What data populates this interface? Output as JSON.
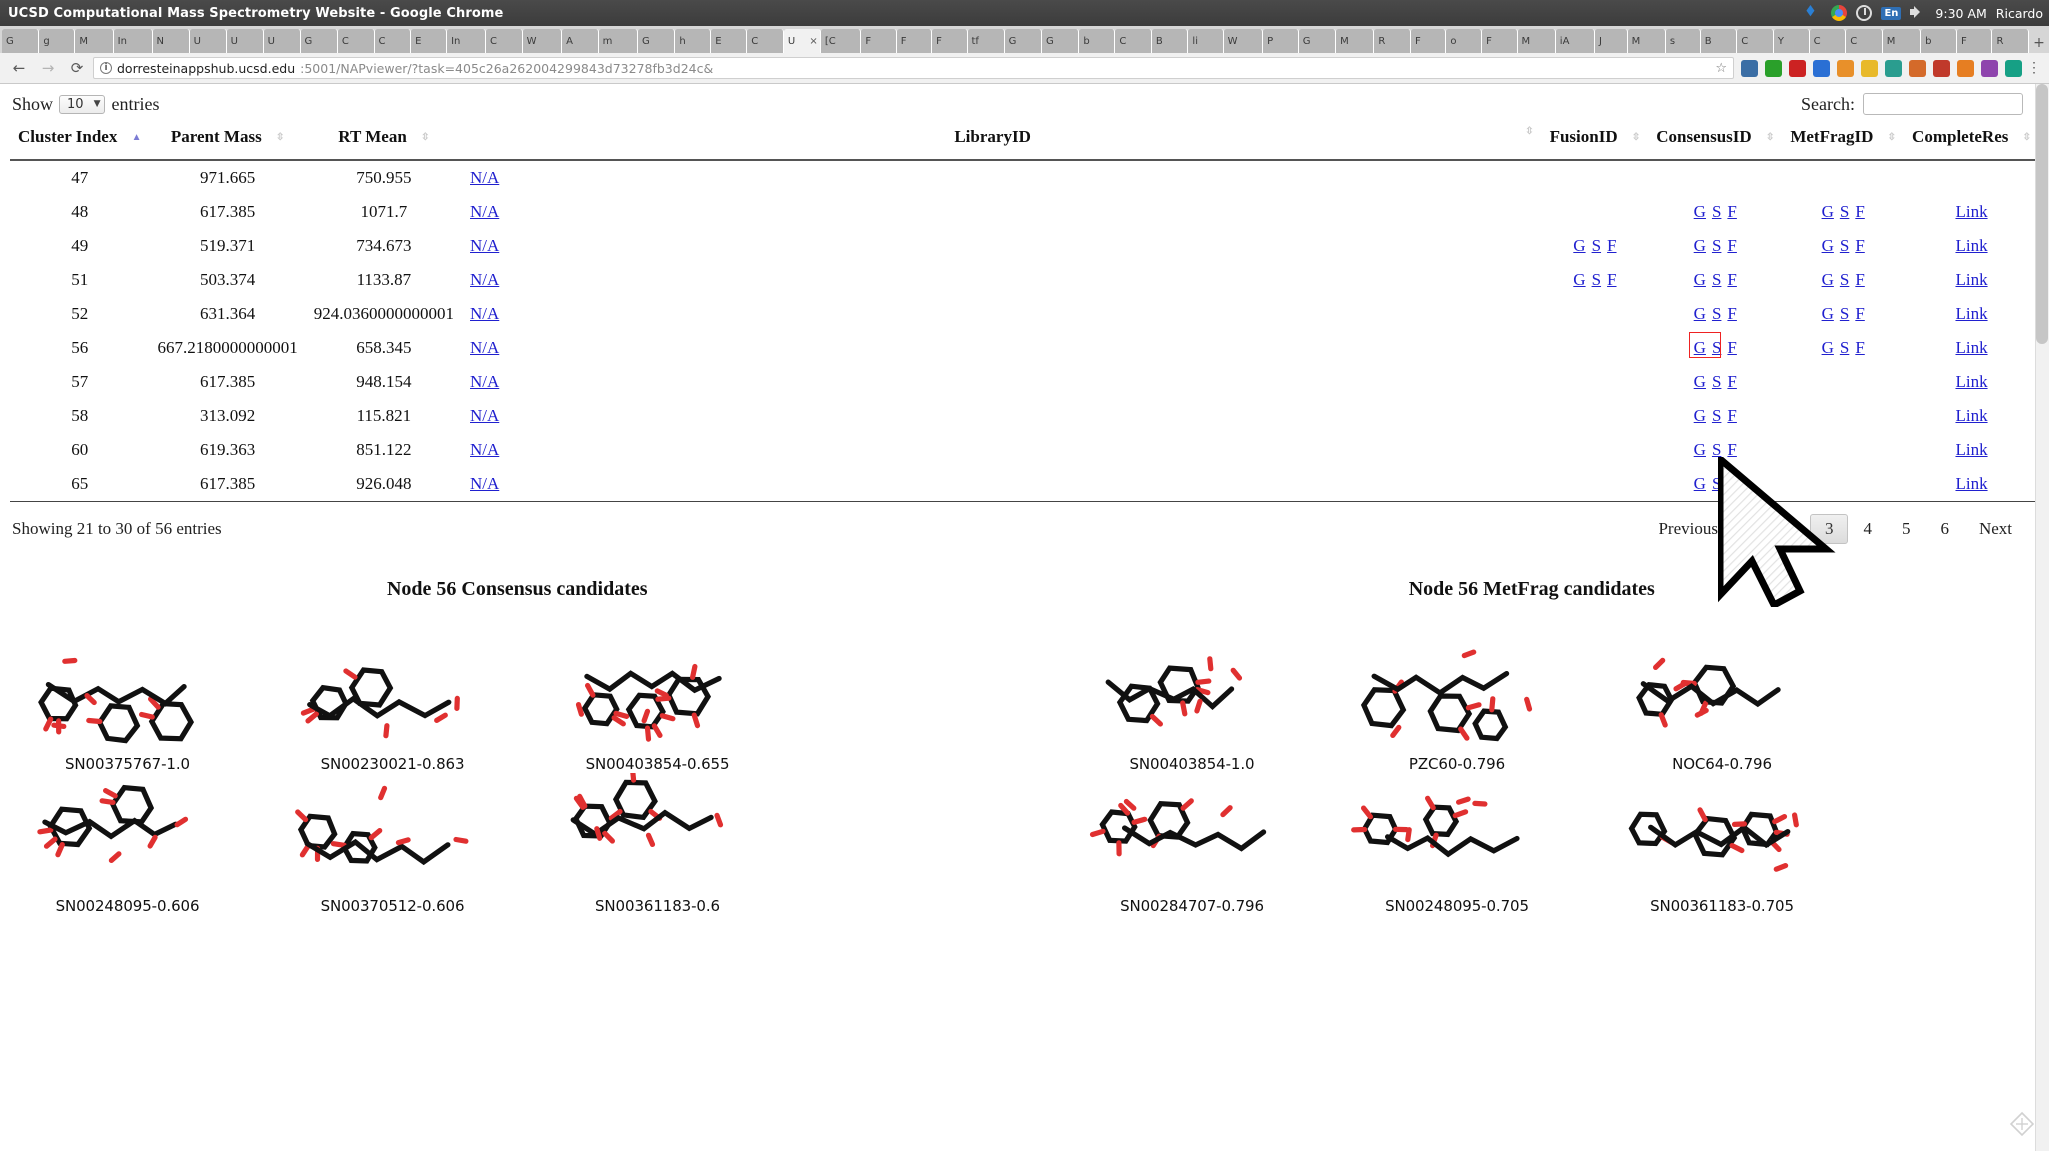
{
  "window": {
    "title": "UCSD Computational Mass Spectrometry Website - Google Chrome",
    "clock": "9:30 AM",
    "user": "Ricardo",
    "lang": "En"
  },
  "browser": {
    "back_icon": "←",
    "forward_icon": "→",
    "reload_icon": "⟳",
    "info_icon": "i",
    "star_icon": "☆",
    "menu_icon": "⋮",
    "new_tab_icon": "+",
    "close_tab_icon": "×",
    "url_host": "dorresteinappshub.ucsd.edu",
    "url_rest": ":5001/NAPviewer/?task=405c26a262004299843d73278fb3d24c&",
    "tabs": [
      "G",
      "g",
      "M",
      "In",
      "N",
      "U",
      "U",
      "U",
      "G",
      "C",
      "C",
      "E",
      "In",
      "C",
      "W",
      "A",
      "m",
      "G",
      "h",
      "E",
      "C",
      "U",
      "[C",
      "F",
      "F",
      "F",
      "tf",
      "G",
      "G",
      "b",
      "C",
      "B",
      "li",
      "W",
      "P",
      "G",
      "M",
      "R",
      "F",
      "o",
      "F",
      "M",
      "iA",
      "J",
      "M",
      "s",
      "B",
      "C",
      "Y",
      "C",
      "C",
      "M",
      "b",
      "F",
      "R"
    ],
    "active_tab_index": 21,
    "extensions": [
      "shield-icon",
      "check-icon",
      "block-icon",
      "bookmark-icon",
      "color-icon",
      "star-icon",
      "globe-icon",
      "puzzle-icon",
      "p-icon",
      "cart-icon",
      "circle-icon",
      "grid-icon"
    ]
  },
  "datatable": {
    "show_label": "Show",
    "entries_label": "entries",
    "page_length": "10",
    "search_label": "Search:",
    "search_value": "",
    "search_placeholder": "",
    "columns": [
      {
        "label": "Cluster Index",
        "sort": "asc"
      },
      {
        "label": "Parent Mass",
        "sort": "none"
      },
      {
        "label": "RT Mean",
        "sort": "none"
      },
      {
        "label": "LibraryID",
        "sort": "none"
      },
      {
        "label": "FusionID",
        "sort": "none"
      },
      {
        "label": "ConsensusID",
        "sort": "none"
      },
      {
        "label": "MetFragID",
        "sort": "none"
      },
      {
        "label": "CompleteRes",
        "sort": "none"
      }
    ],
    "link_labels": {
      "g": "G",
      "s": "S",
      "f": "F",
      "na": "N/A",
      "link": "Link"
    },
    "rows": [
      {
        "cluster": "47",
        "parent_mass": "971.665",
        "rt_mean": "750.955",
        "library": "N/A",
        "fusion": false,
        "consensus": false,
        "metfrag": false,
        "complete": false,
        "highlight": false
      },
      {
        "cluster": "48",
        "parent_mass": "617.385",
        "rt_mean": "1071.7",
        "library": "N/A",
        "fusion": false,
        "consensus": true,
        "metfrag": true,
        "complete": true,
        "highlight": false
      },
      {
        "cluster": "49",
        "parent_mass": "519.371",
        "rt_mean": "734.673",
        "library": "N/A",
        "fusion": true,
        "consensus": true,
        "metfrag": true,
        "complete": true,
        "highlight": false
      },
      {
        "cluster": "51",
        "parent_mass": "503.374",
        "rt_mean": "1133.87",
        "library": "N/A",
        "fusion": true,
        "consensus": true,
        "metfrag": true,
        "complete": true,
        "highlight": false
      },
      {
        "cluster": "52",
        "parent_mass": "631.364",
        "rt_mean": "924.0360000000001",
        "library": "N/A",
        "fusion": false,
        "consensus": true,
        "metfrag": true,
        "complete": true,
        "highlight": false
      },
      {
        "cluster": "56",
        "parent_mass": "667.2180000000001",
        "rt_mean": "658.345",
        "library": "N/A",
        "fusion": false,
        "consensus": true,
        "metfrag": true,
        "complete": true,
        "highlight": true
      },
      {
        "cluster": "57",
        "parent_mass": "617.385",
        "rt_mean": "948.154",
        "library": "N/A",
        "fusion": false,
        "consensus": true,
        "metfrag": false,
        "complete": true,
        "highlight": false
      },
      {
        "cluster": "58",
        "parent_mass": "313.092",
        "rt_mean": "115.821",
        "library": "N/A",
        "fusion": false,
        "consensus": true,
        "metfrag": false,
        "complete": true,
        "highlight": false
      },
      {
        "cluster": "60",
        "parent_mass": "619.363",
        "rt_mean": "851.122",
        "library": "N/A",
        "fusion": false,
        "consensus": true,
        "metfrag": false,
        "complete": true,
        "highlight": false
      },
      {
        "cluster": "65",
        "parent_mass": "617.385",
        "rt_mean": "926.048",
        "library": "N/A",
        "fusion": false,
        "consensus": true,
        "metfrag": false,
        "complete": true,
        "highlight": false
      }
    ],
    "info": "Showing 21 to 30 of 56 entries",
    "pagination": {
      "previous": "Previous",
      "next": "Next",
      "pages": [
        "1",
        "2",
        "3",
        "4",
        "5",
        "6"
      ],
      "current": "3"
    }
  },
  "candidates": {
    "consensus": {
      "title": "Node 56 Consensus candidates",
      "items": [
        "SN00375767-1.0",
        "SN00230021-0.863",
        "SN00403854-0.655",
        "SN00248095-0.606",
        "SN00370512-0.606",
        "SN00361183-0.6"
      ]
    },
    "metfrag": {
      "title": "Node 56 MetFrag candidates",
      "items": [
        "SN00403854-1.0",
        "PZC60-0.796",
        "NOC64-0.796",
        "SN00284707-0.796",
        "SN00248095-0.705",
        "SN00361183-0.705"
      ]
    }
  },
  "colors": {
    "link": "#2020cf",
    "highlight_box": "#ee2222",
    "sort_active": "#7b7bd4",
    "titlebar": "#3c3c3c",
    "oxygen": "#e03030",
    "carbon": "#111111"
  }
}
